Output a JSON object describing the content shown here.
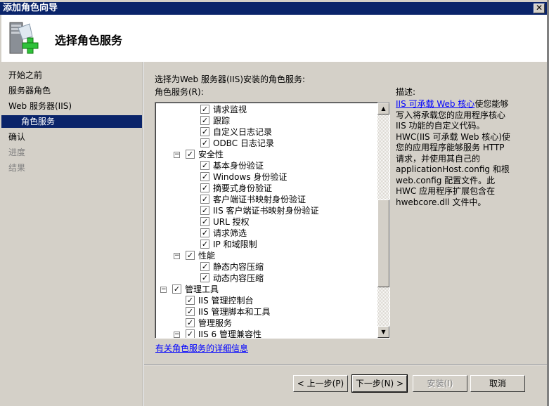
{
  "window": {
    "title": "添加角色向导",
    "close_icon": "close-icon"
  },
  "header": {
    "title": "选择角色服务",
    "icon": "server-add-icon"
  },
  "nav": {
    "items": [
      {
        "label": "开始之前",
        "state": "normal"
      },
      {
        "label": "服务器角色",
        "state": "normal"
      },
      {
        "label": "Web 服务器(IIS)",
        "state": "normal"
      },
      {
        "label": "角色服务",
        "state": "active"
      },
      {
        "label": "确认",
        "state": "normal"
      },
      {
        "label": "进度",
        "state": "disabled"
      },
      {
        "label": "结果",
        "state": "disabled"
      }
    ]
  },
  "main": {
    "instruction": "选择为Web 服务器(IIS)安装的角色服务:",
    "list_label": "角色服务(R):",
    "tree": [
      {
        "level": 3,
        "label": "请求监视",
        "checked": true
      },
      {
        "level": 3,
        "label": "跟踪",
        "checked": true
      },
      {
        "level": 3,
        "label": "自定义日志记录",
        "checked": true
      },
      {
        "level": 3,
        "label": "ODBC 日志记录",
        "checked": true
      },
      {
        "level": 2,
        "label": "安全性",
        "checked": true,
        "expanded": true
      },
      {
        "level": 3,
        "label": "基本身份验证",
        "checked": true
      },
      {
        "level": 3,
        "label": "Windows 身份验证",
        "checked": true
      },
      {
        "level": 3,
        "label": "摘要式身份验证",
        "checked": true
      },
      {
        "level": 3,
        "label": "客户端证书映射身份验证",
        "checked": true
      },
      {
        "level": 3,
        "label": "IIS 客户端证书映射身份验证",
        "checked": true
      },
      {
        "level": 3,
        "label": "URL 授权",
        "checked": true
      },
      {
        "level": 3,
        "label": "请求筛选",
        "checked": true
      },
      {
        "level": 3,
        "label": "IP 和域限制",
        "checked": true
      },
      {
        "level": 2,
        "label": "性能",
        "checked": true,
        "expanded": true
      },
      {
        "level": 3,
        "label": "静态内容压缩",
        "checked": true
      },
      {
        "level": 3,
        "label": "动态内容压缩",
        "checked": true
      },
      {
        "level": 1,
        "label": "管理工具",
        "checked": true,
        "expanded": true
      },
      {
        "level": 2,
        "label": "IIS 管理控制台",
        "checked": true
      },
      {
        "level": 2,
        "label": "IIS 管理脚本和工具",
        "checked": true
      },
      {
        "level": 2,
        "label": "管理服务",
        "checked": true
      },
      {
        "level": 2,
        "label": "IIS 6 管理兼容性",
        "checked": true,
        "expanded": true
      }
    ],
    "more_info_link": "有关角色服务的详细信息"
  },
  "description": {
    "label": "描述:",
    "link": "IIS 可承载 Web 核心",
    "text": "使您能够写入将承载您的应用程序核心 IIS 功能的自定义代码。HWC(IIS 可承载 Web 核心)使您的应用程序能够服务 HTTP 请求，并使用其自己的 applicationHost.config 和根 web.config 配置文件。此 HWC 应用程序扩展包含在 hwebcore.dll 文件中。"
  },
  "buttons": {
    "back": "< 上一步(P)",
    "next": "下一步(N) >",
    "install": "安装(I)",
    "cancel": "取消"
  },
  "colors": {
    "titlebar": "#0a246a",
    "link": "#0000ff",
    "face": "#d4d0c8"
  }
}
